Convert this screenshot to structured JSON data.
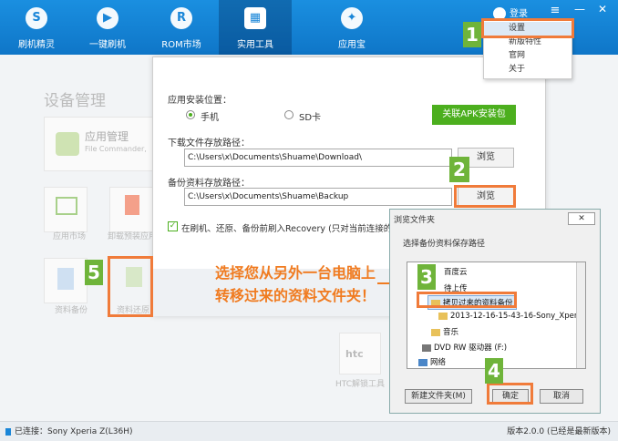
{
  "nav": [
    {
      "label": "刷机精灵",
      "icon": "S"
    },
    {
      "label": "一键刷机",
      "icon": "▶"
    },
    {
      "label": "ROM市场",
      "icon": "R"
    },
    {
      "label": "实用工具",
      "icon": "▦"
    },
    {
      "label": "应用宝",
      "icon": "✦"
    }
  ],
  "top": {
    "login": "登录",
    "menu_icon": "≡",
    "minimize": "—",
    "close": "✕"
  },
  "menu": {
    "items": [
      "设置",
      "新版特性",
      "官网",
      "关于"
    ]
  },
  "bg": {
    "title": "设备管理",
    "app_title": "应用管理",
    "app_sub": "File Commander,",
    "app_market": "应用市场",
    "uninstall": "卸载预装应用",
    "backup": "资料备份",
    "restore": "资料还原",
    "htc": "HTC解锁工具"
  },
  "settings": {
    "install_label": "应用安装位置：",
    "opt_phone": "手机",
    "opt_sd": "SD卡",
    "apk_btn": "关联APK安装包",
    "download_label": "下载文件存放路径：",
    "download_path": "C:\\Users\\x\\Documents\\Shuame\\Download\\",
    "browse": "浏览",
    "backup_label": "备份资料存放路径：",
    "backup_path": "C:\\Users\\x\\Documents\\Shuame\\Backup",
    "checkbox": "在刷机、还原、备份前刷入Recovery (只对当前连接的"
  },
  "callout": [
    "选择您从另外一台电脑上",
    "转移过来的资料文件夹！"
  ],
  "explorer": {
    "title": "浏览文件夹",
    "prompt": "选择备份资料保存路径",
    "tree": [
      "百度云",
      "待上传",
      "拷贝过来的资料备份",
      "2013-12-16-15-43-16-Sony_Xperia",
      "音乐",
      "DVD RW 驱动器 (F:)",
      "网络"
    ],
    "new_folder": "新建文件夹(M)",
    "ok": "确定",
    "cancel": "取消"
  },
  "steps": [
    "1",
    "2",
    "3",
    "4",
    "5"
  ],
  "footer": {
    "left": "已连接：Sony Xperia Z(L36H)",
    "right": "版本2.0.0 (已经是最新版本)"
  },
  "colors": {
    "topbar": "#1a86d8",
    "accent_green": "#4caf1e",
    "highlight": "#f07b3a",
    "step": "#6fb43a"
  }
}
